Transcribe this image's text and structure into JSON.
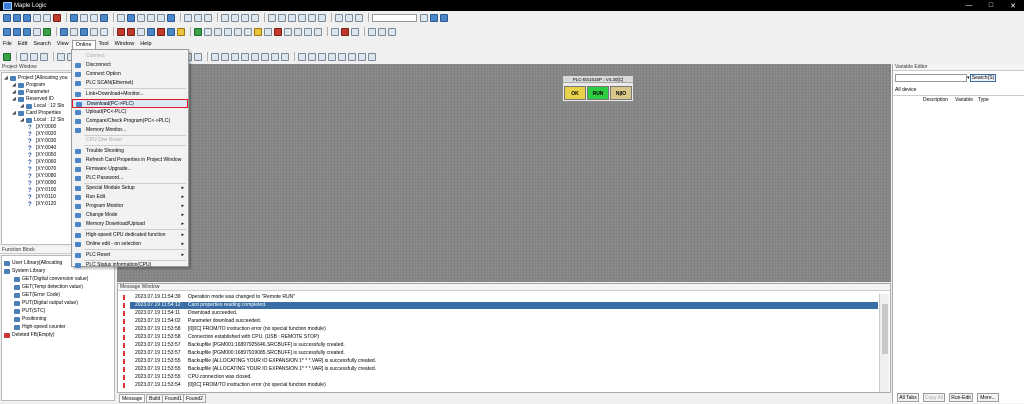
{
  "app_title": "Maple Logic",
  "menus": [
    "File",
    "Edit",
    "Search",
    "View",
    "Online",
    "Tool",
    "Window",
    "Help"
  ],
  "project_window": {
    "header": "Project Window",
    "items": [
      {
        "label": "Project [Allocating you",
        "level": 0
      },
      {
        "label": "Program",
        "level": 1
      },
      {
        "label": "Parameter",
        "level": 1
      },
      {
        "label": "Reserved ID",
        "level": 1
      },
      {
        "label": "Local : 12 Slo",
        "level": 2
      },
      {
        "label": "Card Properties",
        "level": 1
      },
      {
        "label": "Local : 12 Slo",
        "level": 2
      },
      {
        "label": "[XY:0000",
        "level": 3
      },
      {
        "label": "[XY:0020",
        "level": 3
      },
      {
        "label": "[XY:0030",
        "level": 3
      },
      {
        "label": "[XY:0040",
        "level": 3
      },
      {
        "label": "[XY:0050",
        "level": 3
      },
      {
        "label": "[XY:0060",
        "level": 3
      },
      {
        "label": "[XY:0070",
        "level": 3
      },
      {
        "label": "[XY:0080",
        "level": 3
      },
      {
        "label": "[XY:0090",
        "level": 3
      },
      {
        "label": "[XY:0100",
        "level": 3
      },
      {
        "label": "[XY:0110",
        "level": 3
      },
      {
        "label": "[XY:0120",
        "level": 3
      }
    ]
  },
  "function_block": {
    "header": "Function Block",
    "items": [
      {
        "label": "User Library[Allocating",
        "level": 0
      },
      {
        "label": "System Library",
        "level": 0
      },
      {
        "label": "GET(Digital conversion value)",
        "level": 1
      },
      {
        "label": "GET(Temp detection value)",
        "level": 1
      },
      {
        "label": "GET(Error Code)",
        "level": 1
      },
      {
        "label": "PUT(Digital output value)",
        "level": 1
      },
      {
        "label": "PUT(STC)",
        "level": 1
      },
      {
        "label": "Positioning",
        "level": 1
      },
      {
        "label": "High-speed counter",
        "level": 1
      },
      {
        "label": "Deleted FB(Empty)",
        "level": 0
      }
    ]
  },
  "online_menu": {
    "items": [
      {
        "label": "Connect",
        "disabled": true,
        "arrow": false
      },
      {
        "label": "Disconnect",
        "disabled": false,
        "arrow": false
      },
      {
        "label": "Connect Option",
        "disabled": false,
        "arrow": false
      },
      {
        "label": "PLC SCAN(Ethernet)",
        "disabled": false,
        "arrow": false
      },
      {
        "label": "Link+Download+Monitor...",
        "disabled": false,
        "arrow": false
      },
      {
        "label": "Download(PC->PLC)",
        "disabled": false,
        "arrow": false,
        "highlighted": true
      },
      {
        "label": "Upload(PC<-PLC)",
        "disabled": false,
        "arrow": false
      },
      {
        "label": "Compare/Check Program(PC<->PLC)",
        "disabled": false,
        "arrow": false
      },
      {
        "label": "Memory Monitor...",
        "disabled": false,
        "arrow": false
      },
      {
        "label": "CPU One Reset",
        "disabled": true,
        "arrow": false
      },
      {
        "label": "Trouble Shooting",
        "disabled": false,
        "arrow": false
      },
      {
        "label": "Refresh Card Properties in Project Window",
        "disabled": false,
        "arrow": false
      },
      {
        "label": "Firmware Upgrade...",
        "disabled": false,
        "arrow": false
      },
      {
        "label": "PLC Password...",
        "disabled": false,
        "arrow": false
      },
      {
        "label": "Special Module Setup",
        "disabled": false,
        "arrow": true
      },
      {
        "label": "Run Edit",
        "disabled": false,
        "arrow": true
      },
      {
        "label": "Program Monitor",
        "disabled": false,
        "arrow": true
      },
      {
        "label": "Change Mode",
        "disabled": false,
        "arrow": true
      },
      {
        "label": "Memory Download/Upload",
        "disabled": false,
        "arrow": true
      },
      {
        "label": "High-speed CPU dedicated function",
        "disabled": false,
        "arrow": true
      },
      {
        "label": "Online edit - on selection",
        "disabled": false,
        "arrow": true
      },
      {
        "label": "PLC Reset",
        "disabled": false,
        "arrow": true
      },
      {
        "label": "PLC Status information(CPU)",
        "disabled": false,
        "arrow": false
      }
    ]
  },
  "plc_status": {
    "title": "PLC-BS1616P : V4.30[C]",
    "ok": "OK",
    "run": "RUN",
    "nio": "N|IO",
    "ok_color": "#e8d24a",
    "run_color": "#2ecc40",
    "nio_color": "#d9c88a"
  },
  "variable_editor": {
    "header": "Variable Editor",
    "search_label": "Search(S)",
    "tab": "All device",
    "columns": [
      "Description",
      "Variable",
      "Type"
    ],
    "bottom_buttons": [
      "All Tabs",
      "Copy All",
      "Run-Edit",
      "More..."
    ]
  },
  "message_window": {
    "header": "Message Window",
    "rows": [
      {
        "time": "2023.07.19 11:54:39",
        "msg": "Operation mode was changed to \"Remote RUN\""
      },
      {
        "time": "2023.07.19 11:54:12",
        "msg": "Card properties reading completed.",
        "selected": true
      },
      {
        "time": "2023.07.19 11:54:11",
        "msg": "Download succeeded."
      },
      {
        "time": "2023.07.19 11:54:02",
        "msg": "Parameter download succeeded."
      },
      {
        "time": "2023.07.19 11:53:58",
        "msg": "[0]0C] FROM/TO instruction error (no special function module)"
      },
      {
        "time": "2023.07.19 11:53:58",
        "msg": "Connection established with CPU. (USB : REMOTE STOP)"
      },
      {
        "time": "2023.07.19 11:53:57",
        "msg": "Backupfile [PGM001:16897925646.SRCBUFF] is successfully created."
      },
      {
        "time": "2023.07.19 11:53:57",
        "msg": "Backupfile [PGM000:16897919085.SRCBUFF] is successfully created."
      },
      {
        "time": "2023.07.19 11:53:55",
        "msg": "Backupfile [ALLOCATING YOUR IO EXPANSION 1* * *.VAR] is successfully created."
      },
      {
        "time": "2023.07.19 11:53:55",
        "msg": "Backupfile [ALLOCATING YOUR IO EXPANSION 1* * *.VAR] is successfully created."
      },
      {
        "time": "2023.07.19 11:53:55",
        "msg": "CPU connection was closed."
      },
      {
        "time": "2023.07.19 11:53:54",
        "msg": "[0]0C] FROM/TO instruction error (no special function module)"
      }
    ],
    "tabs": [
      "Message",
      "Build",
      "Found1",
      "Found2"
    ]
  }
}
